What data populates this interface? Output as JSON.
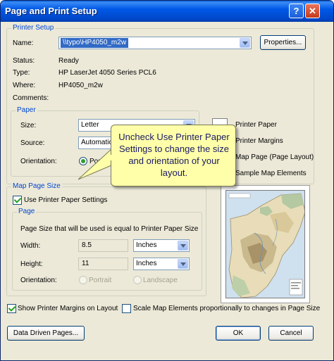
{
  "window": {
    "title": "Page and Print Setup",
    "help_glyph": "?",
    "close_glyph": "✕"
  },
  "printer_setup": {
    "legend": "Printer Setup",
    "name_label": "Name:",
    "name_value": "\\\\typo\\HP4050_m2w",
    "properties_button": "Properties...",
    "status_label": "Status:",
    "status_value": "Ready",
    "type_label": "Type:",
    "type_value": "HP LaserJet 4050 Series PCL6",
    "where_label": "Where:",
    "where_value": "HP4050_m2w",
    "comments_label": "Comments:",
    "paper": {
      "legend": "Paper",
      "size_label": "Size:",
      "size_value": "Letter",
      "source_label": "Source:",
      "source_value": "Automatic",
      "orientation_label": "Orientation:",
      "portrait_label": "Portrait"
    }
  },
  "legend_items": [
    {
      "label": "Printer Paper"
    },
    {
      "label": "Printer Margins"
    },
    {
      "label": "Map Page (Page Layout)"
    },
    {
      "label": "Sample Map Elements"
    }
  ],
  "callout": {
    "text": "Uncheck Use Printer Paper Settings to change the size and orientation of your layout."
  },
  "map_page_size": {
    "legend": "Map Page Size",
    "use_printer_paper_label": "Use Printer Paper Settings",
    "use_printer_paper_checked": true,
    "page": {
      "legend": "Page",
      "info_text": "Page Size that will be used is equal to Printer Paper Size",
      "width_label": "Width:",
      "width_value": "8.5",
      "width_unit": "Inches",
      "height_label": "Height:",
      "height_value": "11",
      "height_unit": "Inches",
      "orientation_label": "Orientation:",
      "portrait_label": "Portrait",
      "landscape_label": "Landscape"
    }
  },
  "show_margins": {
    "label": "Show Printer Margins on Layout",
    "checked": true
  },
  "scale_elements": {
    "label": "Scale Map Elements proportionally to changes in Page Size",
    "checked": false
  },
  "buttons": {
    "data_driven": "Data Driven Pages...",
    "ok": "OK",
    "cancel": "Cancel"
  },
  "colors": {
    "title_bar": "#0055E5",
    "dialog_bg": "#ECE9D8",
    "legend_text": "#0046D5",
    "callout_bg": "#FFFFA9"
  },
  "icons": [
    "window-icon",
    "help-icon",
    "close-icon",
    "dropdown-arrow-icon",
    "map-preview-thumbnail"
  ]
}
